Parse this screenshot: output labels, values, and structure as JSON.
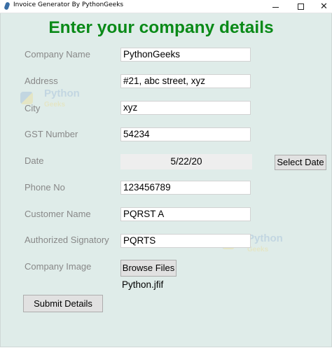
{
  "window": {
    "title": "Invoice Generator By PythonGeeks",
    "minimize": "—",
    "close": "✕"
  },
  "heading": "Enter your company details",
  "fields": {
    "company_name": {
      "label": "Company Name",
      "value": "PythonGeeks"
    },
    "address": {
      "label": "Address",
      "value": "#21, abc street, xyz"
    },
    "city": {
      "label": "City",
      "value": "xyz"
    },
    "gst_number": {
      "label": "GST Number",
      "value": "54234"
    },
    "date": {
      "label": "Date",
      "value": "5/22/20",
      "button": "Select Date"
    },
    "phone_no": {
      "label": "Phone No",
      "value": "123456789"
    },
    "customer_name": {
      "label": "Customer Name",
      "value": "PQRST A"
    },
    "authorized_signatory": {
      "label": "Authorized Signatory",
      "value": "PQRTS"
    },
    "company_image": {
      "label": "Company Image",
      "button": "Browse Files",
      "file": "Python.jfif"
    }
  },
  "submit_label": "Submit Details",
  "watermark": {
    "line1": "Python",
    "line2": "Geeks"
  },
  "colors": {
    "background": "#dfece9",
    "heading": "#0a8a18",
    "label": "#888888"
  }
}
